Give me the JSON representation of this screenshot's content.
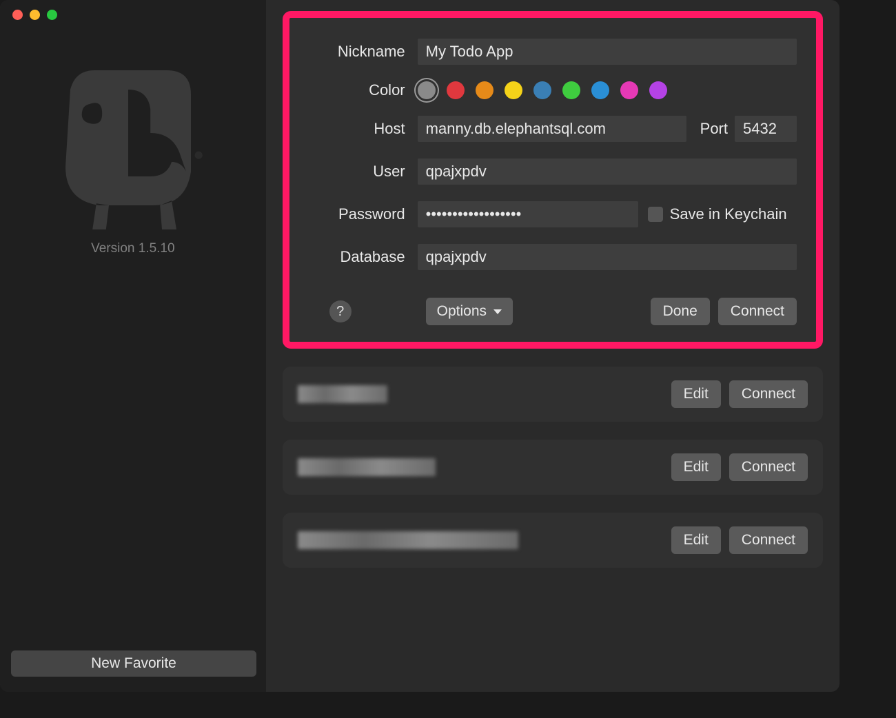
{
  "sidebar": {
    "version": "Version 1.5.10",
    "new_favorite": "New Favorite"
  },
  "connection": {
    "labels": {
      "nickname": "Nickname",
      "color": "Color",
      "host": "Host",
      "port": "Port",
      "user": "User",
      "password": "Password",
      "database": "Database"
    },
    "values": {
      "nickname": "My Todo App",
      "host": "manny.db.elephantsql.com",
      "port": "5432",
      "user": "qpajxpdv",
      "password": "••••••••••••••••••",
      "database": "qpajxpdv"
    },
    "save_keychain": "Save in Keychain",
    "colors": [
      {
        "hex": "#8a8a8a",
        "name": "gray",
        "selected": true
      },
      {
        "hex": "#e0383e",
        "name": "red",
        "selected": false
      },
      {
        "hex": "#e68a19",
        "name": "orange",
        "selected": false
      },
      {
        "hex": "#f5d319",
        "name": "yellow",
        "selected": false
      },
      {
        "hex": "#3a7fb5",
        "name": "teal",
        "selected": false
      },
      {
        "hex": "#3fcc3f",
        "name": "green",
        "selected": false
      },
      {
        "hex": "#2a8fd6",
        "name": "blue",
        "selected": false
      },
      {
        "hex": "#e639b5",
        "name": "pink",
        "selected": false
      },
      {
        "hex": "#b542e6",
        "name": "purple",
        "selected": false
      }
    ],
    "footer": {
      "help": "?",
      "options": "Options",
      "done": "Done",
      "connect": "Connect"
    }
  },
  "saved": {
    "edit": "Edit",
    "connect": "Connect",
    "items": [
      {
        "blur_width": 130
      },
      {
        "blur_width": 200
      },
      {
        "blur_width": 320
      }
    ]
  }
}
